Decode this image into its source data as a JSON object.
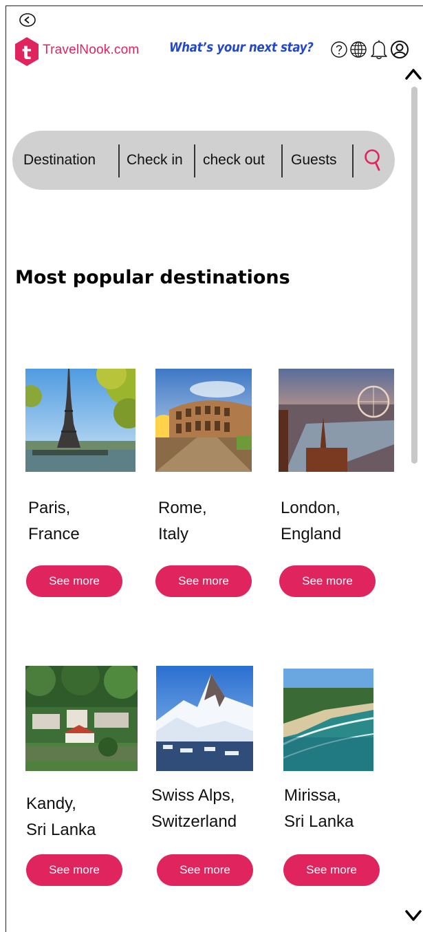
{
  "header": {
    "brand": "TravelNook.com",
    "tagline": "What’s your next stay?",
    "logo_letter": "t",
    "icons": [
      "help-icon",
      "globe-icon",
      "bell-icon",
      "account-icon"
    ]
  },
  "search": {
    "fields": [
      "Destination",
      "Check in",
      "check out",
      "Guests"
    ],
    "icon": "search-icon"
  },
  "section": {
    "title": "Most popular destinations"
  },
  "destinations": [
    {
      "line1": "Paris,",
      "line2": "France",
      "button": "See more"
    },
    {
      "line1": "Rome,",
      "line2": "Italy",
      "button": "See more"
    },
    {
      "line1": "London,",
      "line2": "England",
      "button": "See more"
    },
    {
      "line1": "Kandy,",
      "line2": "Sri Lanka",
      "button": "See more"
    },
    {
      "line1": "Swiss Alps,",
      "line2": "Switzerland",
      "button": "See more"
    },
    {
      "line1": "Mirissa,",
      "line2": "Sri Lanka",
      "button": "See more"
    }
  ],
  "colors": {
    "brand": "#e0245e",
    "tagline": "#2448c9",
    "search_bar": "#d0d0d0"
  }
}
